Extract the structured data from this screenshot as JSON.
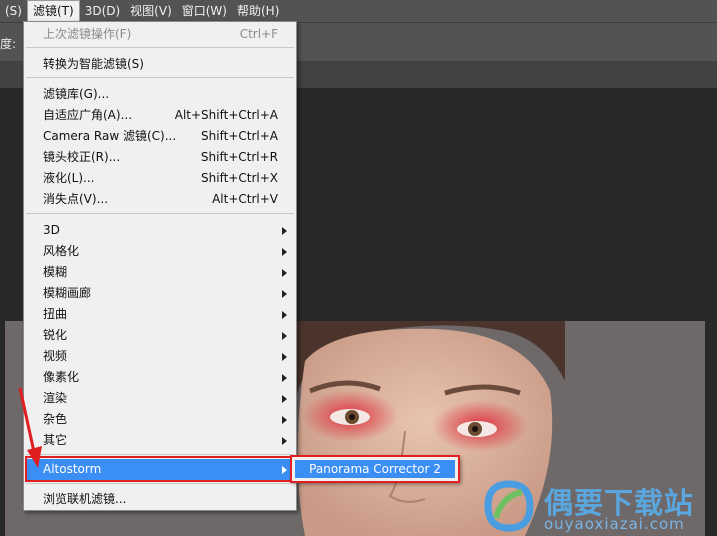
{
  "menubar": {
    "items": [
      "(S)",
      "滤镜(T)",
      "3D(D)",
      "视图(V)",
      "窗口(W)",
      "帮助(H)"
    ],
    "active_index": 1
  },
  "optbar": {
    "label": "度:"
  },
  "filter_menu": {
    "last_filter": {
      "label": "上次滤镜操作(F)",
      "shortcut": "Ctrl+F"
    },
    "smart": {
      "label": "转换为智能滤镜(S)"
    },
    "gallery": {
      "label": "滤镜库(G)..."
    },
    "adaptive": {
      "label": "自适应广角(A)...",
      "shortcut": "Alt+Shift+Ctrl+A"
    },
    "camera_raw": {
      "label": "Camera Raw 滤镜(C)...",
      "shortcut": "Shift+Ctrl+A"
    },
    "lens": {
      "label": "镜头校正(R)...",
      "shortcut": "Shift+Ctrl+R"
    },
    "liquify": {
      "label": "液化(L)...",
      "shortcut": "Shift+Ctrl+X"
    },
    "vanishing": {
      "label": "消失点(V)...",
      "shortcut": "Alt+Ctrl+V"
    },
    "submenus": [
      "3D",
      "风格化",
      "模糊",
      "模糊画廊",
      "扭曲",
      "锐化",
      "视频",
      "像素化",
      "渲染",
      "杂色",
      "其它"
    ],
    "altostorm": {
      "label": "Altostorm"
    },
    "browse": {
      "label": "浏览联机滤镜..."
    }
  },
  "altostorm_submenu": {
    "item": "Panorama Corrector 2"
  },
  "colors": {
    "highlight": "#3b8ef3",
    "annotation": "#e02020",
    "watermark": "#5aa7e0"
  },
  "watermark": {
    "title": "偶要下载站",
    "url": "ouyaoxiazai.com"
  }
}
